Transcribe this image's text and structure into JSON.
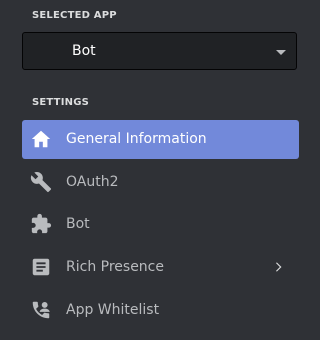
{
  "selected_app": {
    "heading": "SELECTED APP",
    "value": "Bot"
  },
  "settings": {
    "heading": "SETTINGS",
    "items": [
      {
        "label": "General Information",
        "icon": "home-icon",
        "active": true
      },
      {
        "label": "OAuth2",
        "icon": "wrench-icon",
        "active": false
      },
      {
        "label": "Bot",
        "icon": "puzzle-icon",
        "active": false
      },
      {
        "label": "Rich Presence",
        "icon": "document-icon",
        "active": false,
        "has_submenu": true
      },
      {
        "label": "App Whitelist",
        "icon": "person-phone-icon",
        "active": false
      }
    ]
  },
  "colors": {
    "background": "#2f3136",
    "active_item": "#7289da",
    "select_bg": "#202225",
    "text_muted": "#b9bbbe",
    "text_active": "#ffffff"
  }
}
